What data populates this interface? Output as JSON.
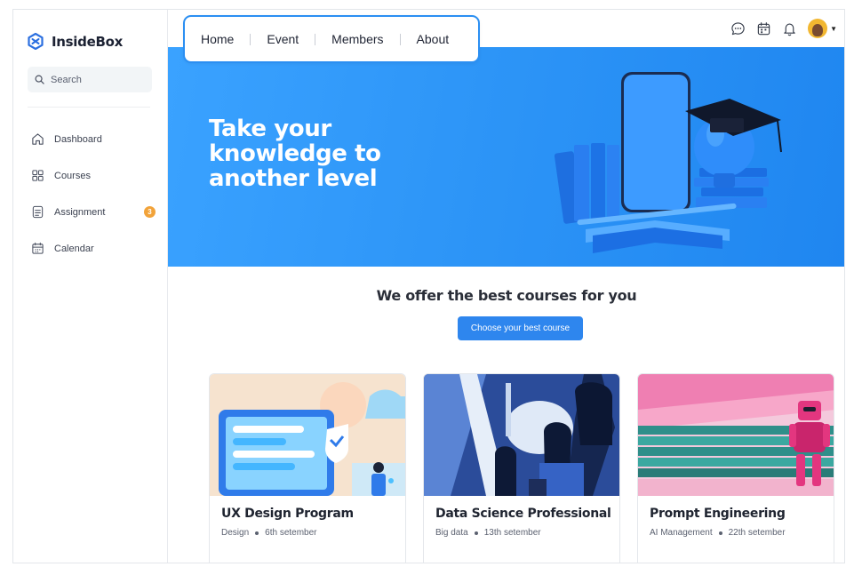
{
  "brand": {
    "name": "InsideBox"
  },
  "search": {
    "placeholder": "Search"
  },
  "sidebar": {
    "items": [
      {
        "label": "Dashboard",
        "icon": "home-icon"
      },
      {
        "label": "Courses",
        "icon": "grid-icon"
      },
      {
        "label": "Assignment",
        "icon": "document-icon",
        "badge": "3"
      },
      {
        "label": "Calendar",
        "icon": "calendar-icon"
      }
    ]
  },
  "topnav": {
    "tabs": [
      "Home",
      "Event",
      "Members",
      "About"
    ]
  },
  "top_icons": [
    "chat-icon",
    "calendar-icon",
    "bell-icon",
    "avatar",
    "chevron-down-icon"
  ],
  "hero": {
    "title": "Take your knowledge to another level"
  },
  "offer": {
    "title": "We offer the best courses for you",
    "cta": "Choose your best course"
  },
  "courses": [
    {
      "title": "UX Design Program",
      "category": "Design",
      "date": "6th setember"
    },
    {
      "title": "Data Science Professional",
      "category": "Big data",
      "date": "13th setember"
    },
    {
      "title": "Prompt Engineering",
      "category": "AI Management",
      "date": "22th setember"
    }
  ],
  "colors": {
    "accent": "#2e86ee",
    "hero": "#2d95f7",
    "badge": "#f2a33a",
    "nav_border": "#2b8ff2"
  }
}
